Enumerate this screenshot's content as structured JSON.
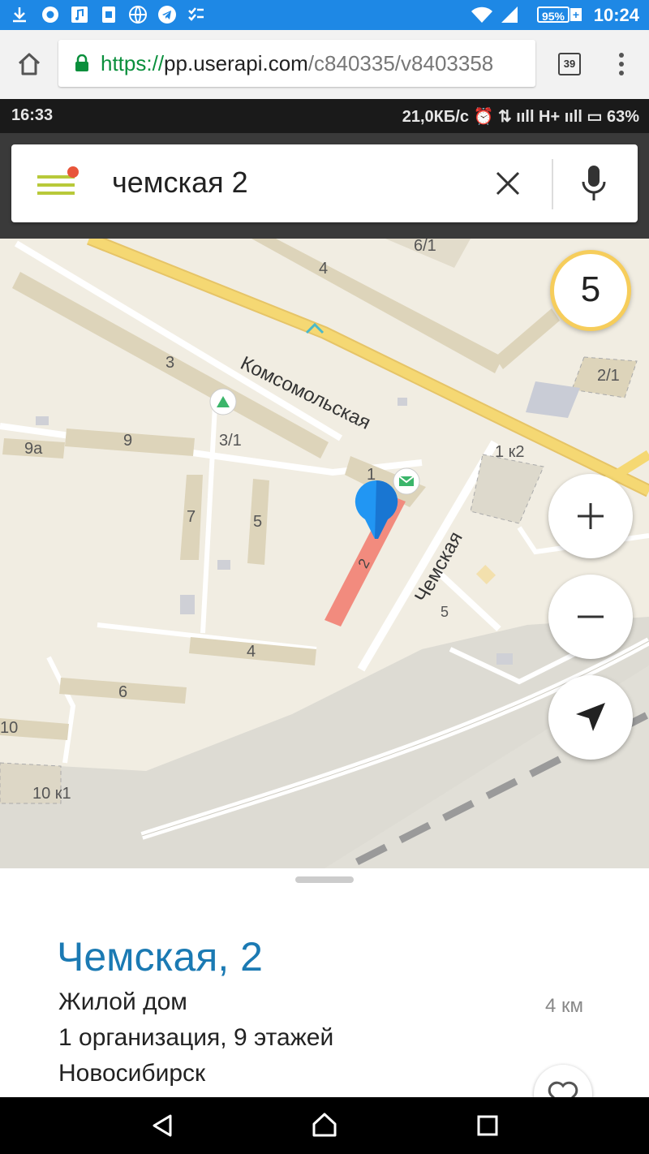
{
  "outer_status": {
    "battery": "95%",
    "battery_plus": "+",
    "time": "10:24"
  },
  "browser": {
    "url_scheme": "https://",
    "url_host": "pp.userapi.com",
    "url_path": "/c840335/v8403358",
    "tab_count": "39"
  },
  "inner_status": {
    "time": "16:33",
    "right": "21,0КБ/с ⏰ ⇅ ııll H+ ııll ▭ 63%"
  },
  "search": {
    "query": "чемская 2"
  },
  "traffic_level": "5",
  "map": {
    "street_main": "Комсомольская",
    "street_side": "Чемская",
    "houses": {
      "h4_top": "4",
      "h6_1": "6/1",
      "h3": "3",
      "h3_1": "3/1",
      "h2_1": "2/1",
      "h1k2": "1 к2",
      "h9a": "9а",
      "h9": "9",
      "h7": "7",
      "h5": "5",
      "h1": "1",
      "h2": "2",
      "h5b": "5",
      "h4": "4",
      "h6": "6",
      "h10": "10",
      "h10k1": "10 к1"
    }
  },
  "card": {
    "title": "Чемская, 2",
    "type": "Жилой дом",
    "info": "1 организация, 9 этажей",
    "city": "Новосибирск",
    "distance": "4 км"
  }
}
